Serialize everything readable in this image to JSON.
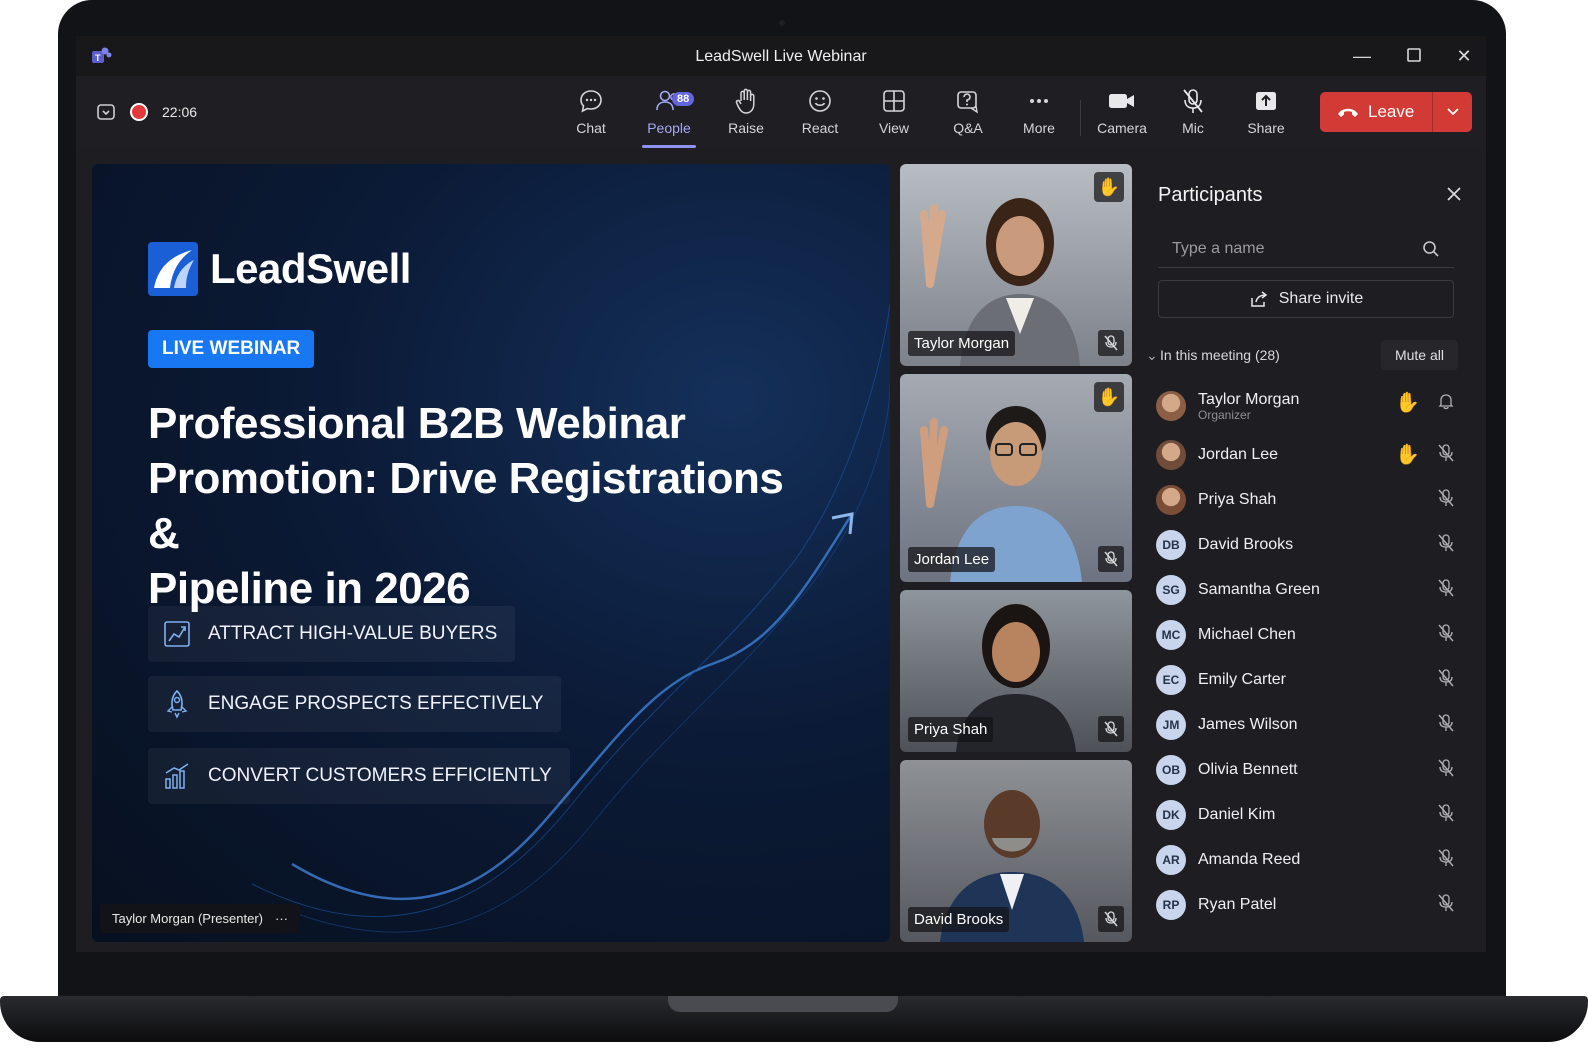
{
  "window": {
    "title": "LeadSwell Live Webinar"
  },
  "toolbar": {
    "timer": "22:06",
    "items": [
      {
        "label": "Chat",
        "icon": "chat-icon"
      },
      {
        "label": "People",
        "icon": "people-icon",
        "badge": "88",
        "active": true
      },
      {
        "label": "Raise",
        "icon": "raise-hand-icon"
      },
      {
        "label": "React",
        "icon": "smiley-icon"
      },
      {
        "label": "View",
        "icon": "grid-icon"
      },
      {
        "label": "Q&A",
        "icon": "qa-icon"
      },
      {
        "label": "More",
        "icon": "more-icon"
      },
      {
        "label": "Camera",
        "icon": "camera-icon"
      },
      {
        "label": "Mic",
        "icon": "mic-off-icon"
      },
      {
        "label": "Share",
        "icon": "share-icon"
      }
    ],
    "leave_label": "Leave",
    "leave_color": "#d23a36",
    "accent_color": "#8f93f0"
  },
  "slide": {
    "brand": "LeadSwell",
    "pill": "LIVE WEBINAR",
    "headline_lines": [
      "Professional B2B Webinar",
      "Promotion: Drive Registrations &",
      "Pipeline in 2026"
    ],
    "features": [
      "ATTRACT HIGH-VALUE BUYERS",
      "ENGAGE PROSPECTS EFFECTIVELY",
      "CONVERT CUSTOMERS EFFICIENTLY"
    ],
    "presenter": "Taylor Morgan (Presenter)",
    "presenter_more": "···"
  },
  "videos": [
    {
      "name": "Taylor Morgan",
      "hand_raised": true
    },
    {
      "name": "Jordan Lee",
      "hand_raised": true
    },
    {
      "name": "Priya Shah",
      "hand_raised": false
    },
    {
      "name": "David Brooks",
      "hand_raised": false
    }
  ],
  "participants": {
    "title": "Participants",
    "search_placeholder": "Type a name",
    "share_invite": "Share invite",
    "section_label": "In this meeting (28)",
    "mute_all": "Mute all",
    "people": [
      {
        "name": "Taylor Morgan",
        "role": "Organizer",
        "initials": "",
        "hand": true,
        "photo": true
      },
      {
        "name": "Jordan Lee",
        "role": "",
        "initials": "",
        "hand": true,
        "photo": true
      },
      {
        "name": "Priya Shah",
        "role": "",
        "initials": "",
        "hand": false,
        "photo": true
      },
      {
        "name": "David Brooks",
        "role": "",
        "initials": "DB",
        "hand": false
      },
      {
        "name": "Samantha Green",
        "role": "",
        "initials": "SG",
        "hand": false
      },
      {
        "name": "Michael Chen",
        "role": "",
        "initials": "MC",
        "hand": false
      },
      {
        "name": "Emily Carter",
        "role": "",
        "initials": "EC",
        "hand": false
      },
      {
        "name": "James Wilson",
        "role": "",
        "initials": "JM",
        "hand": false
      },
      {
        "name": "Olivia Bennett",
        "role": "",
        "initials": "OB",
        "hand": false
      },
      {
        "name": "Daniel Kim",
        "role": "",
        "initials": "DK",
        "hand": false
      },
      {
        "name": "Amanda Reed",
        "role": "",
        "initials": "AR",
        "hand": false
      },
      {
        "name": "Ryan Patel",
        "role": "",
        "initials": "RP",
        "hand": false
      }
    ]
  }
}
